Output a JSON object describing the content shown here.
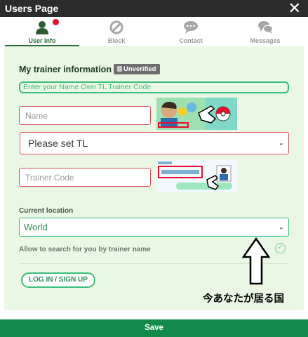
{
  "window": {
    "title": "Users Page",
    "close_icon": "close-icon"
  },
  "tabs": [
    {
      "label": "User Info",
      "icon": "user-icon",
      "active": true,
      "badge": true
    },
    {
      "label": "Block",
      "icon": "block-icon",
      "active": false
    },
    {
      "label": "Contact",
      "icon": "chat-bubble-icon",
      "active": false
    },
    {
      "label": "Messages",
      "icon": "messages-icon",
      "active": false
    }
  ],
  "form": {
    "heading": "My trainer information",
    "status_badge": "Unverified",
    "hint": "Enter your Name Own TL Trainer Code",
    "name_placeholder": "Name",
    "tl_select": "Please set TL",
    "trainer_code_placeholder": "Trainer Code",
    "location_label": "Current location",
    "location_value": "World",
    "allow_search_label": "Allow to search for you by trainer name",
    "login_button": "LOG IN / SIGN UP"
  },
  "annotation": {
    "text": "今あなたが居る国"
  },
  "footer": {
    "save_label": "Save"
  },
  "colors": {
    "accent": "#3bbf7a",
    "save_bar": "#138a4c",
    "error_border": "#d4545e",
    "panel_bg": "#e9f7e4",
    "titlebar": "#2c2c2c"
  }
}
